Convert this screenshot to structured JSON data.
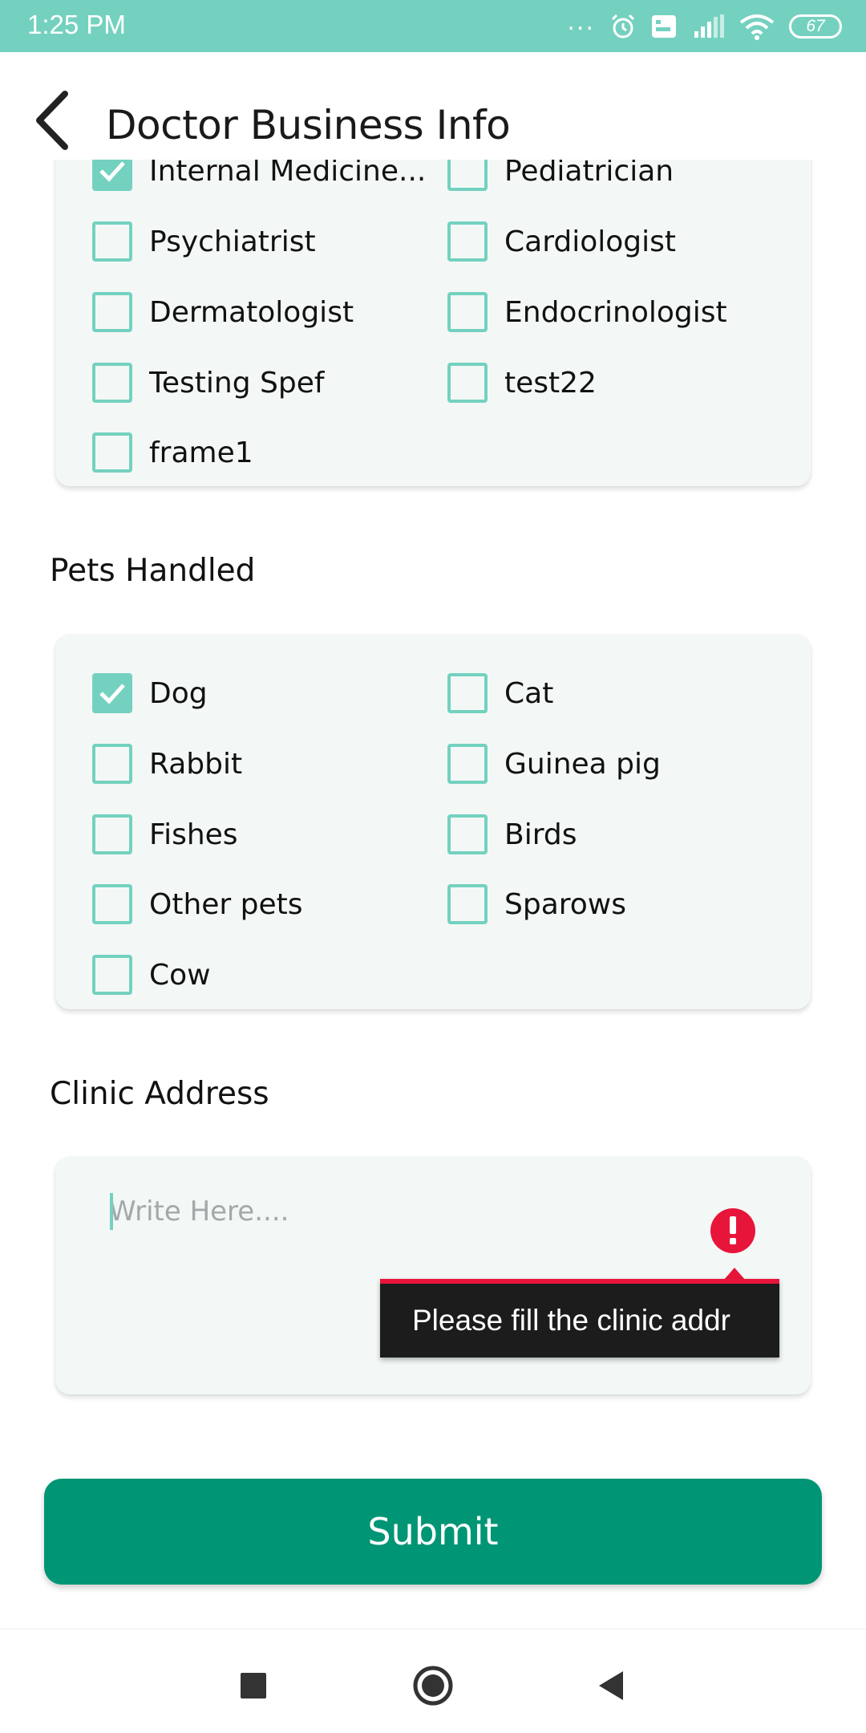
{
  "status_bar": {
    "time": "1:25 PM",
    "dots": "...",
    "battery": "67",
    "icons": [
      "alarm-icon",
      "volte-icon",
      "signal-icon",
      "wifi-icon",
      "battery-icon"
    ]
  },
  "app_bar": {
    "title": "Doctor Business Info",
    "back_icon": "chevron-left-icon"
  },
  "specialties": {
    "options": [
      {
        "label": "Internal Medicine...",
        "checked": true
      },
      {
        "label": "Pediatrician",
        "checked": false
      },
      {
        "label": "Psychiatrist",
        "checked": false
      },
      {
        "label": "Cardiologist",
        "checked": false
      },
      {
        "label": "Dermatologist",
        "checked": false
      },
      {
        "label": "Endocrinologist",
        "checked": false
      },
      {
        "label": "Testing Spef",
        "checked": false
      },
      {
        "label": "test22",
        "checked": false
      },
      {
        "label": "frame1",
        "checked": false
      }
    ]
  },
  "pets": {
    "title": "Pets Handled",
    "options": [
      {
        "label": "Dog",
        "checked": true
      },
      {
        "label": "Cat",
        "checked": false
      },
      {
        "label": "Rabbit",
        "checked": false
      },
      {
        "label": "Guinea pig",
        "checked": false
      },
      {
        "label": "Fishes",
        "checked": false
      },
      {
        "label": "Birds",
        "checked": false
      },
      {
        "label": "Other pets",
        "checked": false
      },
      {
        "label": "Sparows",
        "checked": false
      },
      {
        "label": "Cow",
        "checked": false
      }
    ]
  },
  "clinic_address": {
    "title": "Clinic Address",
    "placeholder": "Write Here....",
    "value": "",
    "error_message": "Please fill the clinic addr"
  },
  "submit": {
    "label": "Submit"
  },
  "colors": {
    "status_bar": "#74d1bf",
    "checkbox": "#74d1bf",
    "submit": "#009574",
    "error": "#e8153b",
    "card_bg": "#f3f8f7"
  }
}
